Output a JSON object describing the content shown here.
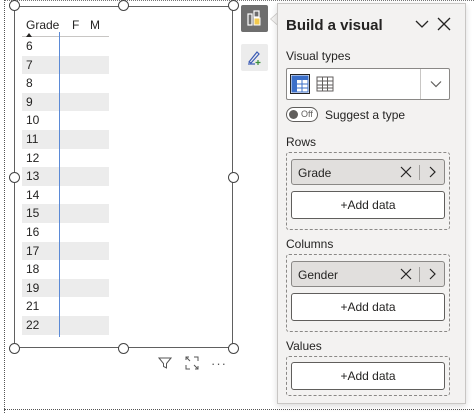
{
  "table_visual": {
    "headers": [
      "Grade",
      "F",
      "M"
    ],
    "rows": [
      "6",
      "7",
      "8",
      "9",
      "10",
      "11",
      "12",
      "13",
      "14",
      "15",
      "16",
      "17",
      "18",
      "19",
      "21",
      "22"
    ]
  },
  "visual_toolbar": {
    "icons": [
      "filter-icon",
      "focus-mode-icon",
      "more-options-icon"
    ],
    "more_label": "···"
  },
  "side_tools": {
    "build_icon": "build-visual-icon",
    "format_icon": "format-visual-icon"
  },
  "pane": {
    "title": "Build a visual",
    "visual_types_label": "Visual types",
    "suggest": {
      "toggle_text": "Off",
      "label": "Suggest a type"
    },
    "rows": {
      "label": "Rows",
      "field": "Grade",
      "add_label": "+Add data"
    },
    "columns": {
      "label": "Columns",
      "field": "Gender",
      "add_label": "+Add data"
    },
    "values": {
      "label": "Values",
      "add_label": "+Add data"
    }
  },
  "colors": {
    "accent_blue": "#5b8ad6",
    "pane_bg": "#f3f2f1",
    "alt_row": "#ececec",
    "active_tool": "#6e6e6e"
  }
}
